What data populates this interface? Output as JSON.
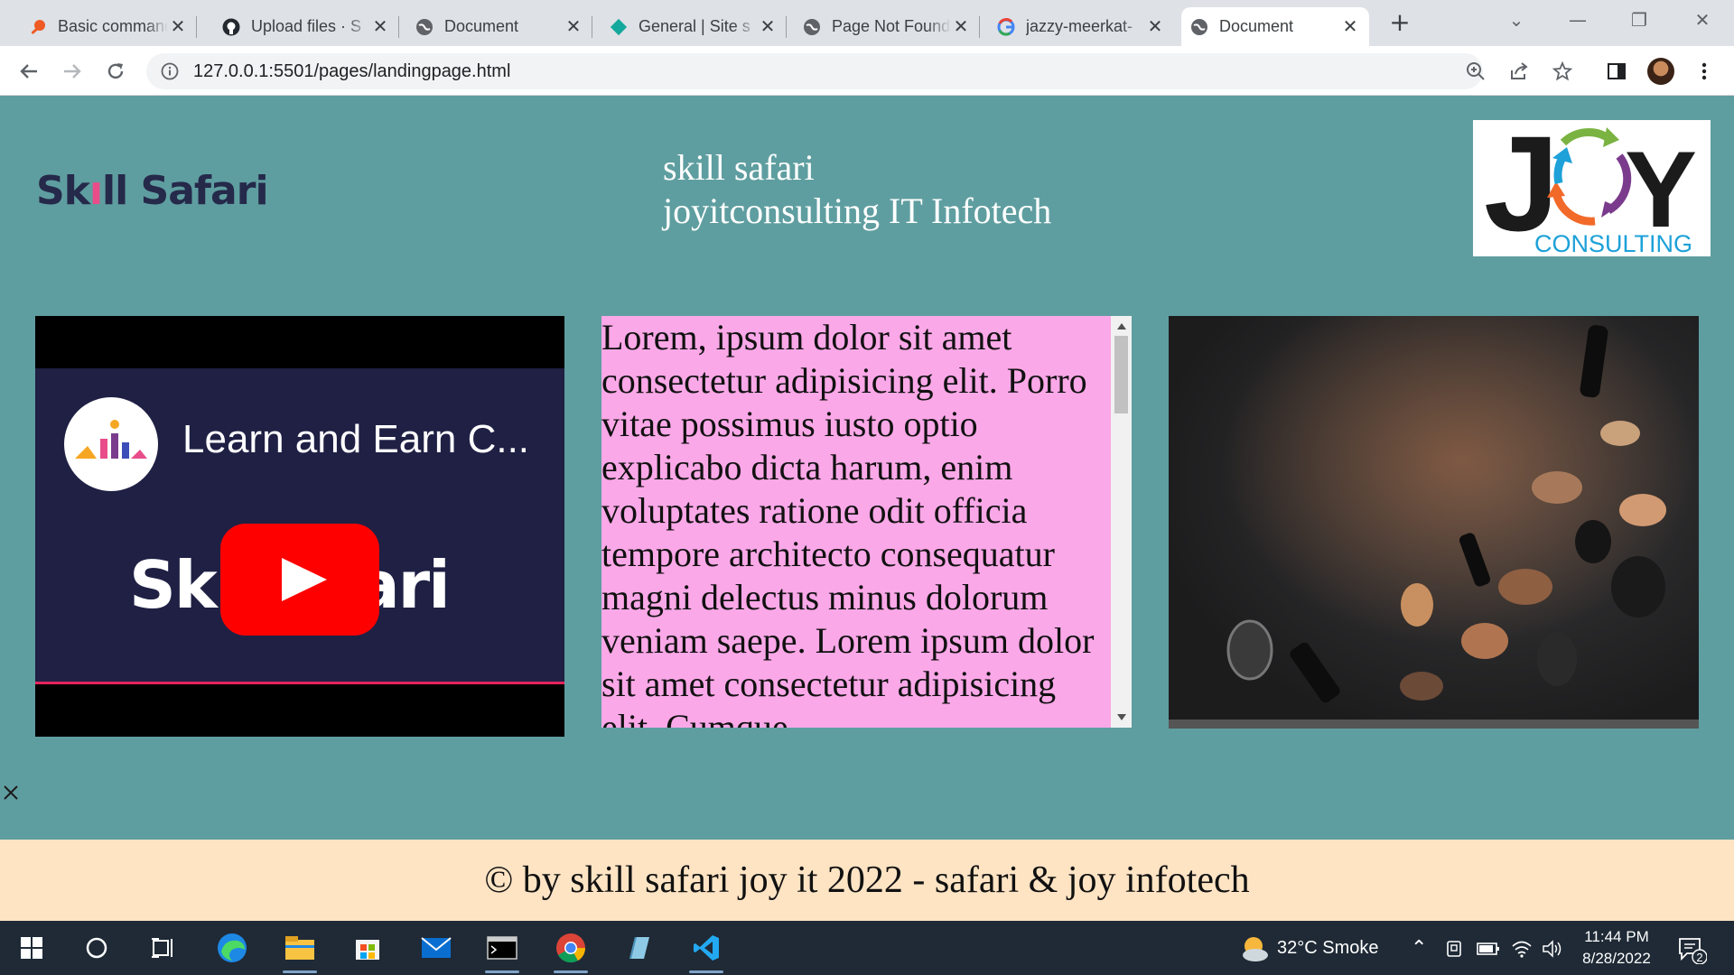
{
  "browser": {
    "tabs": [
      {
        "title": "Basic commands"
      },
      {
        "title": "Upload files · S"
      },
      {
        "title": "Document"
      },
      {
        "title": "General | Site s"
      },
      {
        "title": "Page Not Found"
      },
      {
        "title": "jazzy-meerkat-"
      },
      {
        "title": "Document"
      }
    ],
    "url": "127.0.0.1:5501/pages/landingpage.html"
  },
  "page": {
    "brand": {
      "part1": "Sk",
      "part2": "ll Safari"
    },
    "heading": {
      "line1": "skill safari",
      "line2": "joyitconsulting IT Infotech"
    },
    "joy_logo": {
      "letters_left": "J",
      "letters_right": "Y",
      "sub": "CONSULTING"
    },
    "video": {
      "title": "Learn and Earn C...",
      "overlay_left": "Sk",
      "overlay_right": "fari"
    },
    "text_block": "Lorem, ipsum dolor sit amet consectetur adipisicing elit. Porro vitae possimus iusto optio explicabo dicta harum, enim voluptates ratione odit officia tempore architecto consequatur magni delectus minus dolorum veniam saepe. Lorem ipsum dolor sit amet consectetur adipisicing elit. Cumque",
    "footer": "© by skill safari joy it 2022 - safari & joy infotech"
  },
  "taskbar": {
    "weather": "32°C  Smoke",
    "time": "11:44 PM",
    "date": "8/28/2022",
    "notification_count": "2"
  }
}
